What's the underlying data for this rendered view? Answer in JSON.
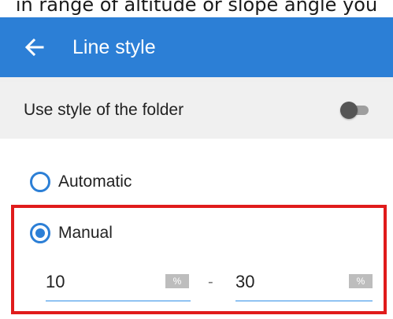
{
  "caption": "in range of altitude or slope angle you",
  "appbar": {
    "title": "Line style",
    "back_icon": "arrow-left-icon",
    "color": "#2c7fd6"
  },
  "folder_style": {
    "label": "Use style of the folder",
    "toggle_on": false
  },
  "options": {
    "automatic": {
      "label": "Automatic",
      "selected": false
    },
    "manual": {
      "label": "Manual",
      "selected": true
    }
  },
  "range": {
    "from": {
      "value": "10",
      "unit": "%"
    },
    "separator": "-",
    "to": {
      "value": "30",
      "unit": "%"
    }
  },
  "highlight_color": "#e01b1b"
}
